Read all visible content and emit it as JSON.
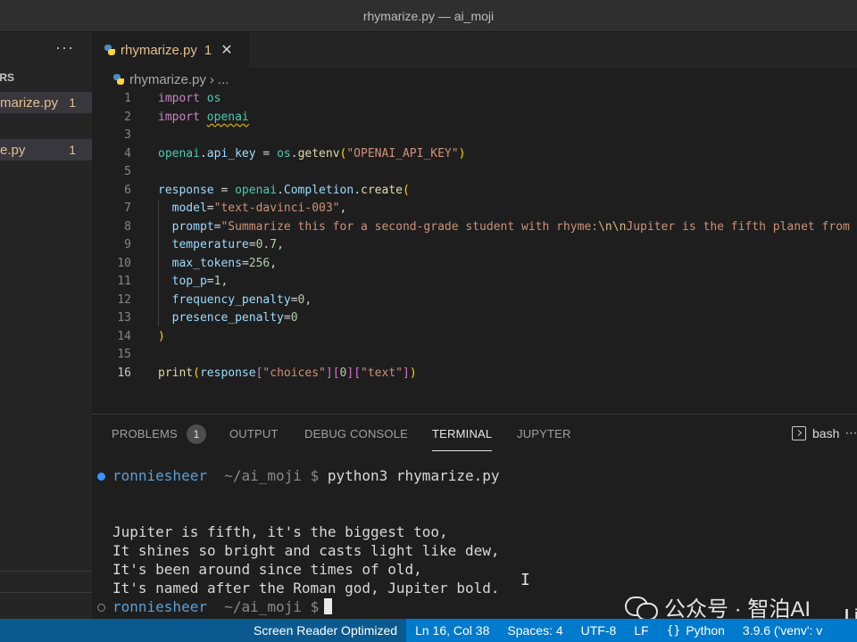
{
  "window": {
    "title": "rhymarize.py — ai_moji"
  },
  "sidebar": {
    "more": "···",
    "section_label": "ORS",
    "files": [
      {
        "name": "marize.py",
        "count": "1"
      },
      {
        "name": "e.py",
        "count": "1"
      }
    ]
  },
  "tab": {
    "filename": "rhymarize.py",
    "count": "1",
    "close": "✕"
  },
  "breadcrumb": {
    "file": "rhymarize.py",
    "sep": "›",
    "rest": "..."
  },
  "code": {
    "line_numbers": [
      "1",
      "2",
      "3",
      "4",
      "5",
      "6",
      "7",
      "8",
      "9",
      "10",
      "11",
      "12",
      "13",
      "14",
      "15",
      "16"
    ],
    "current_line": 16,
    "l1_kw": "import",
    "l1_mod": "os",
    "l2_kw": "import",
    "l2_mod": "openai",
    "l4_a": "openai",
    "l4_b": ".",
    "l4_c": "api_key",
    "l4_d": " = ",
    "l4_e": "os",
    "l4_f": ".",
    "l4_g": "getenv",
    "l4_h": "(",
    "l4_i": "\"OPENAI_API_KEY\"",
    "l4_j": ")",
    "l6_a": "response",
    "l6_b": " = ",
    "l6_c": "openai",
    "l6_d": ".",
    "l6_e": "Completion",
    "l6_f": ".",
    "l6_g": "create",
    "l6_h": "(",
    "l7_a": "model",
    "l7_b": "=",
    "l7_c": "\"text-davinci-003\"",
    "l7_d": ",",
    "l8_a": "prompt",
    "l8_b": "=",
    "l8_c": "\"Summarize this for a second-grade student with rhyme:",
    "l8_d": "\\n\\n",
    "l8_e": "Jupiter is the fifth planet from",
    "l9_a": "temperature",
    "l9_b": "=",
    "l9_c": "0.7",
    "l9_d": ",",
    "l10_a": "max_tokens",
    "l10_b": "=",
    "l10_c": "256",
    "l10_d": ",",
    "l11_a": "top_p",
    "l11_b": "=",
    "l11_c": "1",
    "l11_d": ",",
    "l12_a": "frequency_penalty",
    "l12_b": "=",
    "l12_c": "0",
    "l12_d": ",",
    "l13_a": "presence_penalty",
    "l13_b": "=",
    "l13_c": "0",
    "l14_a": ")",
    "l16_a": "print",
    "l16_b": "(",
    "l16_c": "response",
    "l16_d": "[",
    "l16_e": "\"choices\"",
    "l16_f": "]",
    "l16_g": "[",
    "l16_h": "0",
    "l16_i": "]",
    "l16_j": "[",
    "l16_k": "\"text\"",
    "l16_l": "]",
    "l16_m": ")"
  },
  "panel": {
    "tabs": [
      "PROBLEMS",
      "OUTPUT",
      "DEBUG CONSOLE",
      "TERMINAL",
      "JUPYTER"
    ],
    "active_tab": "TERMINAL",
    "problems_count": "1",
    "shell": "bash",
    "shell_more": "⋯"
  },
  "terminal": {
    "user": "ronniesheer",
    "path": "~/ai_moji $",
    "command": "python3 rhymarize.py",
    "output": [
      "Jupiter is fifth, it's the biggest too,",
      "It shines so bright and casts light like dew,",
      "It's been around since times of old,",
      "It's named after the Roman god, Jupiter bold."
    ],
    "cursor_glyph": "I"
  },
  "watermark": {
    "text": "公众号 · 智泊AI",
    "edge": "Li"
  },
  "statusbar": {
    "screen_reader": "Screen Reader Optimized",
    "position": "Ln 16, Col 38",
    "spaces": "Spaces: 4",
    "encoding": "UTF-8",
    "eol": "LF",
    "lang_icon": "{}",
    "language": "Python",
    "interpreter": "3.9.6 ('venv': v"
  },
  "colors": {
    "accent": "#007acc",
    "statusbar_dark": "#0b5a8f",
    "warning_file": "#e2c08d",
    "keyword": "#c586c0",
    "string": "#ce9178",
    "variable": "#9cdcfe",
    "function": "#dcdcaa",
    "number": "#b5cea8"
  }
}
